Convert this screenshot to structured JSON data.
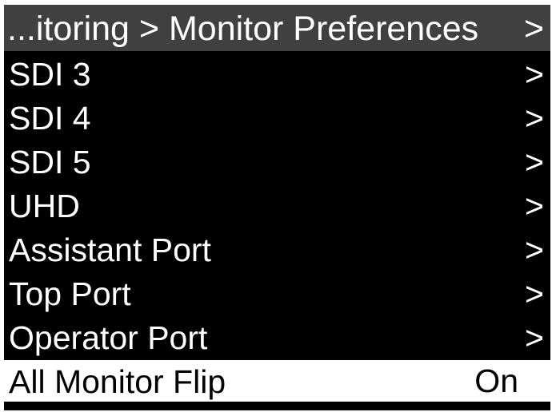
{
  "header": {
    "title": "...itoring > Monitor Preferences",
    "chevron": ">",
    "chevron_icon": "chevron-right-icon"
  },
  "menu": {
    "items": [
      {
        "label": "SDI 3",
        "chevron": ">"
      },
      {
        "label": "SDI 4",
        "chevron": ">"
      },
      {
        "label": "SDI 5",
        "chevron": ">"
      },
      {
        "label": "UHD",
        "chevron": ">"
      },
      {
        "label": "Assistant Port",
        "chevron": ">"
      },
      {
        "label": "Top Port",
        "chevron": ">"
      },
      {
        "label": "Operator Port",
        "chevron": ">"
      }
    ],
    "selected_item": {
      "label": "All Monitor Flip",
      "value": "On"
    }
  },
  "colors": {
    "background": "#000000",
    "header_background": "#404040",
    "text": "#ffffff",
    "selected_background": "#ffffff",
    "selected_text": "#000000"
  }
}
